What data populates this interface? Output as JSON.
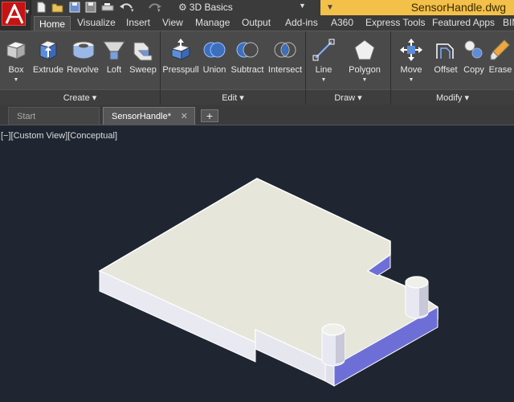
{
  "app": {
    "workspace": "3D Basics",
    "document_title": "SensorHandle.dwg"
  },
  "ribbon_tabs": [
    "Home",
    "Visualize",
    "Insert",
    "View",
    "Manage",
    "Output",
    "Add-ins",
    "A360",
    "Express Tools",
    "Featured Apps",
    "BIM"
  ],
  "active_tab": "Home",
  "ribbon": {
    "create": {
      "title": "Create",
      "tools": [
        {
          "label": "Box",
          "icon": "box-icon",
          "has_dropdown": true
        },
        {
          "label": "Extrude",
          "icon": "extrude-icon",
          "has_dropdown": false
        },
        {
          "label": "Revolve",
          "icon": "revolve-icon",
          "has_dropdown": false
        },
        {
          "label": "Loft",
          "icon": "loft-icon",
          "has_dropdown": false
        },
        {
          "label": "Sweep",
          "icon": "sweep-icon",
          "has_dropdown": false
        }
      ]
    },
    "edit": {
      "title": "Edit",
      "tools": [
        {
          "label": "Presspull",
          "icon": "presspull-icon"
        },
        {
          "label": "Union",
          "icon": "union-icon"
        },
        {
          "label": "Subtract",
          "icon": "subtract-icon"
        },
        {
          "label": "Intersect",
          "icon": "intersect-icon"
        }
      ]
    },
    "draw": {
      "title": "Draw",
      "tools": [
        {
          "label": "Line",
          "icon": "line-icon",
          "has_dropdown": true
        },
        {
          "label": "Polygon",
          "icon": "polygon-icon",
          "has_dropdown": true
        }
      ]
    },
    "modify": {
      "title": "Modify",
      "tools": [
        {
          "label": "Move",
          "icon": "move-icon",
          "has_dropdown": true
        },
        {
          "label": "Offset",
          "icon": "offset-icon"
        },
        {
          "label": "Copy",
          "icon": "copy-icon"
        },
        {
          "label": "Erase",
          "icon": "erase-icon"
        }
      ]
    }
  },
  "file_tabs": {
    "start": "Start",
    "document": "SensorHandle*"
  },
  "viewport": {
    "controls": "[−][Custom View][Conceptual]"
  },
  "colors": {
    "title_tab": "#f3c04a",
    "viewport_bg": "#1f2632",
    "model_top": "#e6e6da",
    "model_side_light": "#ececf6",
    "model_side_shadow": "#6f6fd6"
  }
}
